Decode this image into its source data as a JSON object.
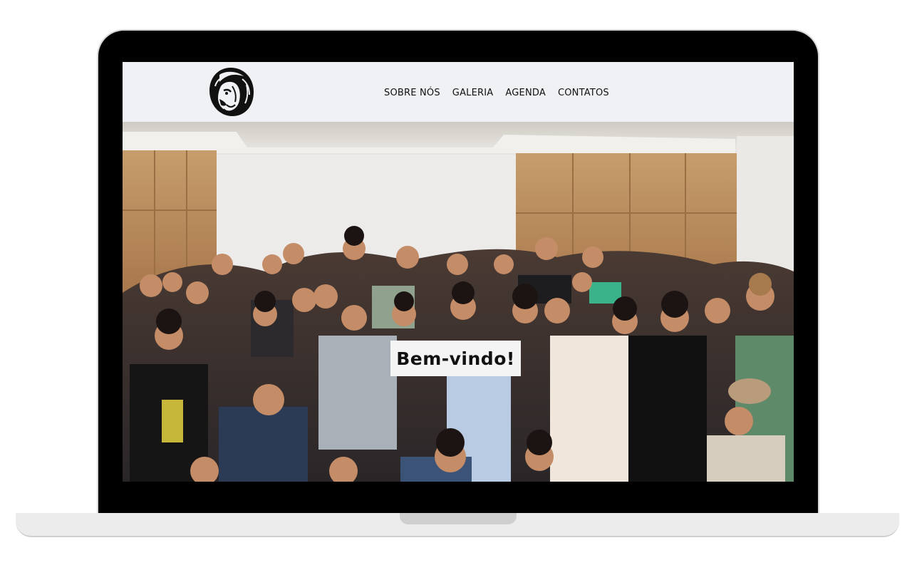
{
  "site": {
    "nav": {
      "items": [
        {
          "label": "SOBRE NÓS"
        },
        {
          "label": "GALERIA"
        },
        {
          "label": "AGENDA"
        },
        {
          "label": "CONTATOS"
        }
      ]
    },
    "hero": {
      "welcome_text": "Bem-vindo!"
    }
  },
  "icons": {
    "logo": "lion-head-icon"
  }
}
